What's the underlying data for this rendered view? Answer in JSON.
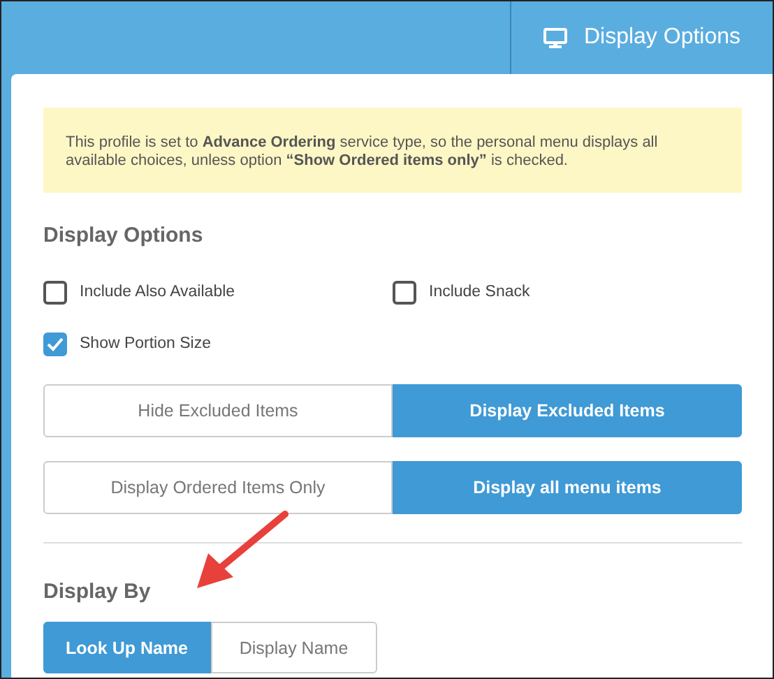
{
  "header": {
    "tab": {
      "label": "Display Options",
      "selected": true
    }
  },
  "notice": "This profile is set to **Advance Ordering** service type, so the personal menu displays all available choices, unless option **“Show Ordered items only”** is checked.",
  "display_options": {
    "title": "Display Options",
    "checkboxes": [
      {
        "label": "Include Also Available",
        "checked": false
      },
      {
        "label": "Include Snack",
        "checked": false
      },
      {
        "label": "Show Portion Size",
        "checked": true
      }
    ],
    "toggles": [
      {
        "options": [
          {
            "label": "Hide Excluded Items",
            "selected": false
          },
          {
            "label": "Display Excluded Items",
            "selected": true
          }
        ]
      },
      {
        "options": [
          {
            "label": "Display Ordered Items Only",
            "selected": false
          },
          {
            "label": "Display all menu items",
            "selected": true
          }
        ]
      }
    ]
  },
  "display_by": {
    "title": "Display By",
    "options": [
      {
        "label": "Look Up Name",
        "selected": true
      },
      {
        "label": "Display Name",
        "selected": false
      }
    ]
  }
}
